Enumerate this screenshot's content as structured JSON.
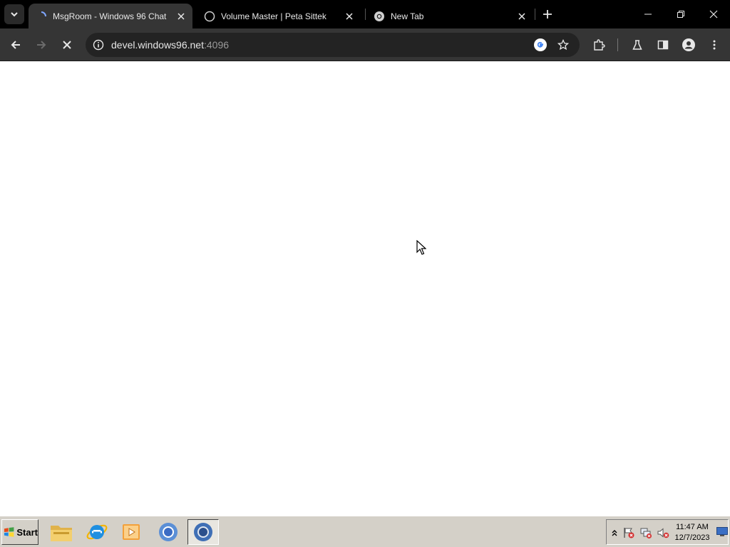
{
  "browser": {
    "tabs": [
      {
        "title": "MsgRoom - Windows 96 Chat",
        "active": true
      },
      {
        "title": "Volume Master | Peta Sittek",
        "active": false
      },
      {
        "title": "New Tab",
        "active": false
      }
    ],
    "address": {
      "host": "devel.windows96.net",
      "port": ":4096"
    }
  },
  "taskbar": {
    "start_label": "Start",
    "quick_launch": [
      "file-explorer-icon",
      "internet-explorer-icon",
      "media-player-icon",
      "chrome-icon",
      "chromium-icon"
    ],
    "clock": {
      "time": "11:47 AM",
      "date": "12/7/2023"
    }
  },
  "colors": {
    "tabstrip": "#000000",
    "toolbar": "#353535",
    "omnibox": "#232323",
    "taskbar": "#d4d0c8"
  }
}
